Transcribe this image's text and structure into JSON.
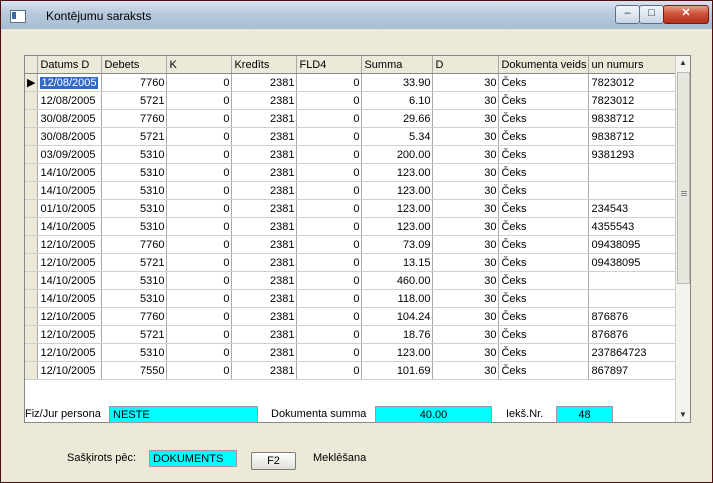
{
  "window": {
    "title": "Kontējumu saraksts",
    "minimize": "–",
    "maximize": "□",
    "close": "✕"
  },
  "grid": {
    "columns": [
      "Datums  D",
      "Debets",
      "K",
      "Kredīts",
      "FLD4",
      "Summa",
      "D",
      "Dokumenta veids",
      "un numurs"
    ],
    "rows": [
      [
        "12/08/2005",
        "7760",
        "0",
        "2381",
        "0",
        "33.90",
        "30",
        "Čeks",
        "7823012"
      ],
      [
        "12/08/2005",
        "5721",
        "0",
        "2381",
        "0",
        "6.10",
        "30",
        "Čeks",
        "7823012"
      ],
      [
        "30/08/2005",
        "7760",
        "0",
        "2381",
        "0",
        "29.66",
        "30",
        "Čeks",
        "9838712"
      ],
      [
        "30/08/2005",
        "5721",
        "0",
        "2381",
        "0",
        "5.34",
        "30",
        "Čeks",
        "9838712"
      ],
      [
        "03/09/2005",
        "5310",
        "0",
        "2381",
        "0",
        "200.00",
        "30",
        "Čeks",
        "9381293"
      ],
      [
        "14/10/2005",
        "5310",
        "0",
        "2381",
        "0",
        "123.00",
        "30",
        "Čeks",
        ""
      ],
      [
        "14/10/2005",
        "5310",
        "0",
        "2381",
        "0",
        "123.00",
        "30",
        "Čeks",
        ""
      ],
      [
        "01/10/2005",
        "5310",
        "0",
        "2381",
        "0",
        "123.00",
        "30",
        "Čeks",
        "234543"
      ],
      [
        "14/10/2005",
        "5310",
        "0",
        "2381",
        "0",
        "123.00",
        "30",
        "Čeks",
        "4355543"
      ],
      [
        "12/10/2005",
        "7760",
        "0",
        "2381",
        "0",
        "73.09",
        "30",
        "Čeks",
        "09438095"
      ],
      [
        "12/10/2005",
        "5721",
        "0",
        "2381",
        "0",
        "13.15",
        "30",
        "Čeks",
        "09438095"
      ],
      [
        "14/10/2005",
        "5310",
        "0",
        "2381",
        "0",
        "460.00",
        "30",
        "Čeks",
        ""
      ],
      [
        "14/10/2005",
        "5310",
        "0",
        "2381",
        "0",
        "118.00",
        "30",
        "Čeks",
        ""
      ],
      [
        "12/10/2005",
        "7760",
        "0",
        "2381",
        "0",
        "104.24",
        "30",
        "Čeks",
        "876876"
      ],
      [
        "12/10/2005",
        "5721",
        "0",
        "2381",
        "0",
        "18.76",
        "30",
        "Čeks",
        "876876"
      ],
      [
        "12/10/2005",
        "5310",
        "0",
        "2381",
        "0",
        "123.00",
        "30",
        "Čeks",
        "237864723"
      ],
      [
        "12/10/2005",
        "7550",
        "0",
        "2381",
        "0",
        "101.69",
        "30",
        "Čeks",
        "867897"
      ]
    ],
    "current_row_marker": "▶"
  },
  "footer": {
    "fiz_jur_label": "Fiz/Jur persona",
    "fiz_jur_value": "NESTE",
    "doc_sum_label": "Dokumenta summa",
    "doc_sum_value": "40.00",
    "iek_nr_label": "Iekš.Nr.",
    "iek_nr_value": "48",
    "sort_label": "Sašķirots pēc:",
    "sort_value": "DOKUMENTS",
    "f2_button": "F2",
    "search_label": "Meklēšana"
  },
  "colors": {
    "field_bg": "#00ffff",
    "selection": "#316ac5"
  }
}
